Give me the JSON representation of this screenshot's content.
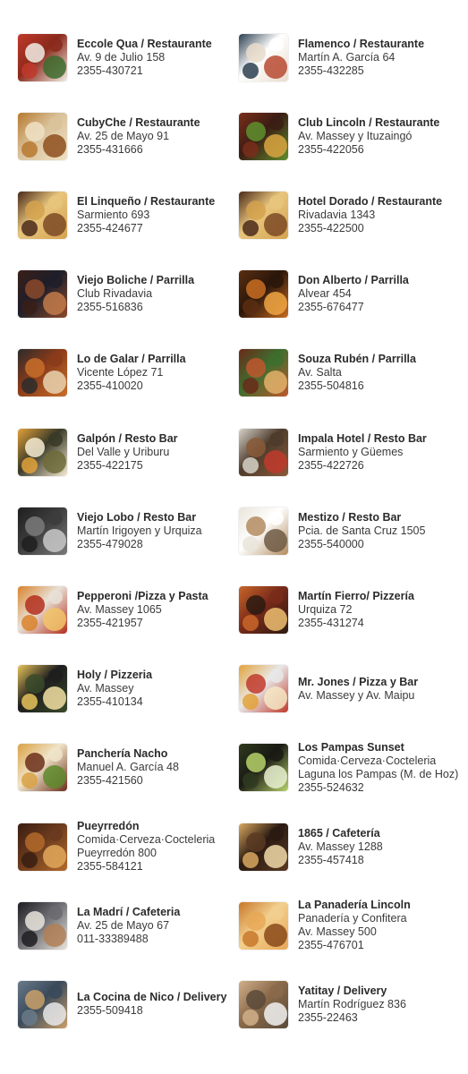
{
  "entries": [
    {
      "name": "Eccole Qua / Restaurante",
      "lines": [
        "Av. 9 de Julio 158",
        "2355-430721"
      ],
      "image": "caprese-salad-photo",
      "palette": [
        "#c0392b",
        "#f1ede4",
        "#3d6b2e",
        "#8a2a1c"
      ]
    },
    {
      "name": "Flamenco / Restaurante",
      "lines": [
        "Martín A. García 64",
        "2355-432285"
      ],
      "image": "dinner-table-photo",
      "palette": [
        "#2c3e50",
        "#e8dccb",
        "#b84a32",
        "#ffffff"
      ]
    },
    {
      "name": "CubyChe / Restaurante",
      "lines": [
        "Av. 25 de Mayo 91",
        "2355-431666"
      ],
      "image": "plated-food-photo",
      "palette": [
        "#b7792f",
        "#efe0c4",
        "#8e4f1f",
        "#d9c29a"
      ]
    },
    {
      "name": "Club Lincoln / Restaurante",
      "lines": [
        "Av. Massey y Ituzaingó",
        "2355-422056"
      ],
      "image": "steak-salad-photo",
      "palette": [
        "#7a2e1a",
        "#5f8f2d",
        "#d9a441",
        "#3b1d14"
      ]
    },
    {
      "name": "El Linqueño / Restaurante",
      "lines": [
        "Sarmiento 693",
        "2355-424677"
      ],
      "image": "steak-fries-photo",
      "palette": [
        "#4a2a1a",
        "#d4a24e",
        "#7c4a26",
        "#e8c57d"
      ]
    },
    {
      "name": "Hotel Dorado / Restaurante",
      "lines": [
        "Rivadavia 1343",
        "2355-422500"
      ],
      "image": "steak-fries-photo",
      "palette": [
        "#4a2a1a",
        "#d4a24e",
        "#7c4a26",
        "#e8c57d"
      ]
    },
    {
      "name": "Viejo Boliche / Parrilla",
      "lines": [
        "Club Rivadavia",
        "2355-516836"
      ],
      "image": "grilled-meat-photo",
      "palette": [
        "#3a1f17",
        "#8b4a2b",
        "#c27b4a",
        "#1e1e2a"
      ]
    },
    {
      "name": "Don Alberto / Parrilla",
      "lines": [
        "Alvear 454",
        "2355-676477"
      ],
      "image": "restaurant-interior-photo",
      "palette": [
        "#5a2e12",
        "#c96d22",
        "#f0a643",
        "#2a160a"
      ]
    },
    {
      "name": "Lo de Galar / Parrilla",
      "lines": [
        "Vicente López 71",
        "2355-410020"
      ],
      "image": "grill-board-photo",
      "palette": [
        "#2b2b2b",
        "#c86f2a",
        "#e9d3b0",
        "#8a3b1a"
      ]
    },
    {
      "name": "Souza Rubén / Parrilla",
      "lines": [
        "Av. Salta",
        "2355-504816"
      ],
      "image": "mixed-grill-photo",
      "palette": [
        "#6b2a1a",
        "#c0572e",
        "#e3b26a",
        "#3d6e2e"
      ]
    },
    {
      "name": "Galpón / Resto Bar",
      "lines": [
        "Del Valle y Uriburu",
        "2355-422175"
      ],
      "image": "beer-glass-photo",
      "palette": [
        "#e2a23a",
        "#f7ecd3",
        "#6d6b3a",
        "#3a3a28"
      ]
    },
    {
      "name": "Impala Hotel / Resto Bar",
      "lines": [
        "Sarmiento y Güemes",
        "2355-422726"
      ],
      "image": "table-dishes-photo",
      "palette": [
        "#d6d2c9",
        "#8a5a3a",
        "#c0392b",
        "#4d3b2b"
      ]
    },
    {
      "name": "Viejo Lobo / Resto Bar",
      "lines": [
        "Martín Irigoyen y Urquiza",
        "2355-479028"
      ],
      "image": "beer-tap-photo",
      "palette": [
        "#1f1f1f",
        "#7a7a7a",
        "#c9c9c9",
        "#3c3c3c"
      ]
    },
    {
      "name": "Mestizo / Resto Bar",
      "lines": [
        "Pcia. de Santa Cruz 1505",
        "2355-540000"
      ],
      "image": "cafe-table-photo",
      "palette": [
        "#e9e4da",
        "#b28b5f",
        "#6f5a44",
        "#ffffff"
      ]
    },
    {
      "name": "Pepperoni /Pizza y Pasta",
      "lines": [
        "Av. Massey 1065",
        "2355-421957"
      ],
      "image": "pepperoni-pizza-photo",
      "palette": [
        "#d9822b",
        "#b32f1c",
        "#f2c46a",
        "#e8e1d6"
      ]
    },
    {
      "name": "Martín Fierro/ Pizzería",
      "lines": [
        "Urquiza 72",
        "2355-431274"
      ],
      "image": "olive-pizza-photo",
      "palette": [
        "#c9662a",
        "#2b1a12",
        "#efc071",
        "#7a2b1a"
      ]
    },
    {
      "name": "Holy / Pizzeria",
      "lines": [
        "Av. Massey",
        "2355-410134"
      ],
      "image": "cheese-pizza-photo",
      "palette": [
        "#e7c45a",
        "#3a4a2a",
        "#f3e1a3",
        "#1e1e1e"
      ]
    },
    {
      "name": "Mr. Jones / Pizza y Bar",
      "lines": [
        "Av. Massey y Av. Maipu"
      ],
      "image": "pizza-beer-photo",
      "palette": [
        "#e2a23a",
        "#c0392b",
        "#f5e7c4",
        "#e8e8e8"
      ]
    },
    {
      "name": "Panchería Nacho",
      "lines": [
        "Manuel A. García 48",
        "2355-421560"
      ],
      "image": "burger-photo",
      "palette": [
        "#d9a144",
        "#6b2e1a",
        "#5e8a2d",
        "#f0e4c8"
      ]
    },
    {
      "name": "Los Pampas Sunset",
      "lines": [
        "Comida·Cerveza·Cocteleria",
        "Laguna los Pampas (M. de Hoz)",
        "2355-524632"
      ],
      "image": "cocktail-photo",
      "palette": [
        "#2f3a1e",
        "#b7d36a",
        "#e8f0d0",
        "#1a1a14"
      ]
    },
    {
      "name": "Pueyrredón",
      "lines": [
        "Comida·Cerveza·Cocteleria",
        "Pueyrredón 800",
        "2355-584121"
      ],
      "image": "tapas-photo",
      "palette": [
        "#3a1e12",
        "#b36a2a",
        "#e0a85a",
        "#6a3a1e"
      ]
    },
    {
      "name": "1865 / Cafetería",
      "lines": [
        "Av. Massey 1288",
        "2355-457418"
      ],
      "image": "cake-slice-photo",
      "palette": [
        "#d9a860",
        "#5a3a22",
        "#f0d9a8",
        "#2a1a12"
      ]
    },
    {
      "name": "La Madrí / Cafeteria",
      "lines": [
        "Av. 25 de Mayo 67",
        "011-33389488"
      ],
      "image": "coffee-cup-photo",
      "palette": [
        "#1e1e22",
        "#e9e4dc",
        "#b08055",
        "#6a6a70"
      ]
    },
    {
      "name": "La Panadería Lincoln",
      "lines": [
        "Panadería y Confitera",
        "Av. Massey 500",
        "2355-476701"
      ],
      "image": "bread-rolls-photo",
      "palette": [
        "#c8782a",
        "#e8a856",
        "#8a4a1a",
        "#f2cf8e"
      ]
    },
    {
      "name": "La Cocina de Nico / Delivery",
      "lines": [
        "2355-509418"
      ],
      "image": "delivery-bag-photo",
      "palette": [
        "#6a7a8a",
        "#c9a06a",
        "#e8e8ea",
        "#3a4a5a"
      ]
    },
    {
      "name": "Yatitay / Delivery",
      "lines": [
        "Martín Rodríguez 836",
        "2355-22463"
      ],
      "image": "delivery-handoff-photo",
      "palette": [
        "#d0b08a",
        "#5a4a3a",
        "#f2f2f2",
        "#8a6a4a"
      ]
    }
  ]
}
